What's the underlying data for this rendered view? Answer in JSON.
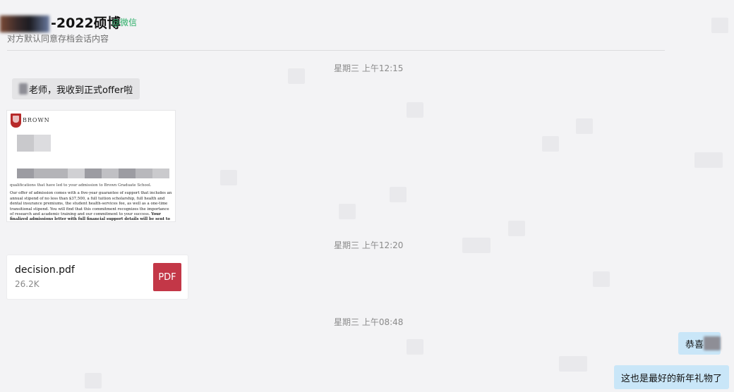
{
  "header": {
    "title": "-2022硕博",
    "wechat_tag": "@微信",
    "subtitle": "对方默认同意存档会话内容"
  },
  "timestamps": {
    "t1": "星期三 上午12:15",
    "t2": "星期三 上午12:20",
    "t3": "星期三 上午08:48"
  },
  "messages": {
    "offer_text": "老师，我收到正式offer啦",
    "congrats_text": "恭喜",
    "gift_text": "这也是最好的新年礼物了"
  },
  "offer_image": {
    "org": "BROWN",
    "letter_line1": "qualifications that have led to your admission to Brown Graduate School.",
    "letter_body": "Our offer of admission comes with a five-year guarantee of support that includes an annual stipend of no less than $37,500, a full tuition scholarship, full health and dental insurance premiums, the student health-services fee, as well as a one-time transitional stipend. You will find that this commitment recognizes the importance of research and academic training and our commitment to your success.",
    "letter_bold": "Your finalized admissions letter with full financial support details will be sent to you following the meeting of the Brown Corporation in late February."
  },
  "file": {
    "name": "decision.pdf",
    "size": "26.2K",
    "icon_label": "PDF",
    "icon_color": "#c33747"
  },
  "colors": {
    "wechat_green": "#2aae67",
    "bubble_right": "#c9e6f8",
    "bubble_left": "#e4e4e6"
  }
}
